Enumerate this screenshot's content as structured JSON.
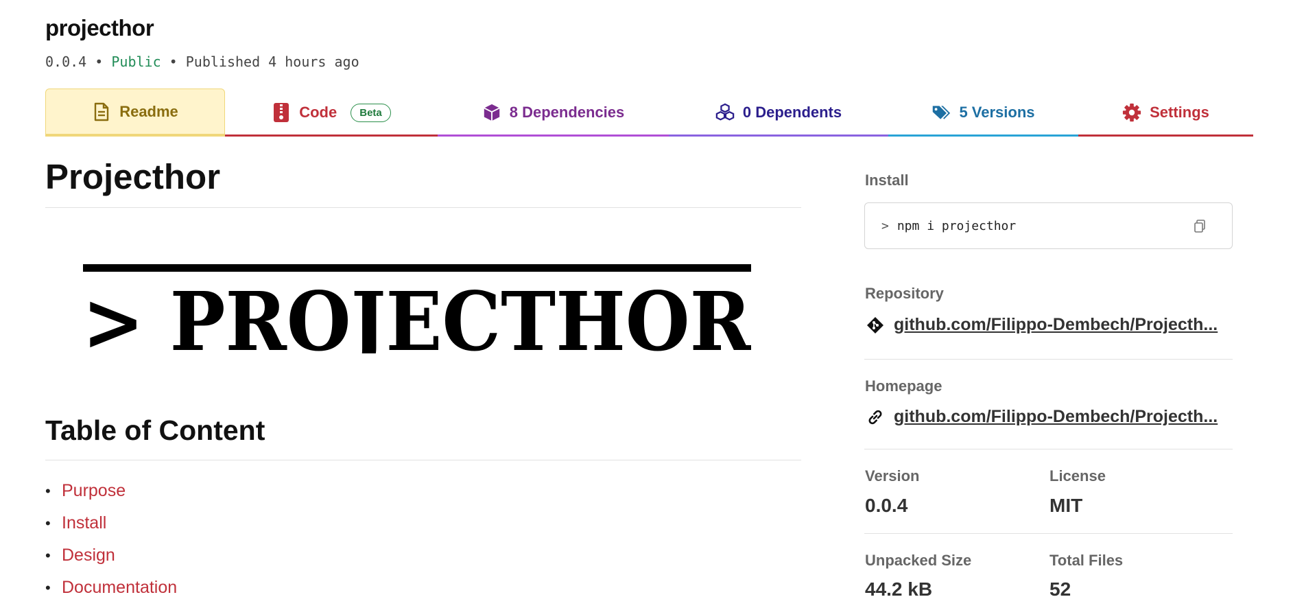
{
  "package": {
    "name": "projecthor",
    "version": "0.0.4",
    "visibility": "Public",
    "published": "Published 4 hours ago",
    "separator": "•"
  },
  "tabs": [
    {
      "label": "Readme",
      "icon": "readme-file-icon",
      "color": "#8a6d0f",
      "underline": "#f0d77a"
    },
    {
      "label": "Code",
      "icon": "code-zip-icon",
      "badge": "Beta",
      "color": "#c0303a",
      "underline": "#c0303a"
    },
    {
      "label": "8 Dependencies",
      "icon": "dependencies-box-icon",
      "color": "#7b2c8f",
      "underline": "#b04fd6"
    },
    {
      "label": "0 Dependents",
      "icon": "dependents-boxes-icon",
      "color": "#2b1e8c",
      "underline": "#8a63e0"
    },
    {
      "label": "5 Versions",
      "icon": "versions-tags-icon",
      "color": "#1d6fa3",
      "underline": "#29a3d6"
    },
    {
      "label": "Settings",
      "icon": "settings-gear-icon",
      "color": "#c0303a",
      "underline": "#c0303a"
    }
  ],
  "readme": {
    "title": "Projecthor",
    "logo_text": "> PROJECTHOR",
    "toc_title": "Table of Content",
    "toc_items": [
      "Purpose",
      "Install",
      "Design",
      "Documentation"
    ]
  },
  "sidebar": {
    "install_label": "Install",
    "install_prompt": ">",
    "install_command": "npm i projecthor",
    "repository_label": "Repository",
    "repository_link": "github.com/Filippo-Dembech/Projecth...",
    "homepage_label": "Homepage",
    "homepage_link": "github.com/Filippo-Dembech/Projecth...",
    "version_label": "Version",
    "version_value": "0.0.4",
    "license_label": "License",
    "license_value": "MIT",
    "unpacked_size_label": "Unpacked Size",
    "unpacked_size_value": "44.2 kB",
    "total_files_label": "Total Files",
    "total_files_value": "52"
  }
}
